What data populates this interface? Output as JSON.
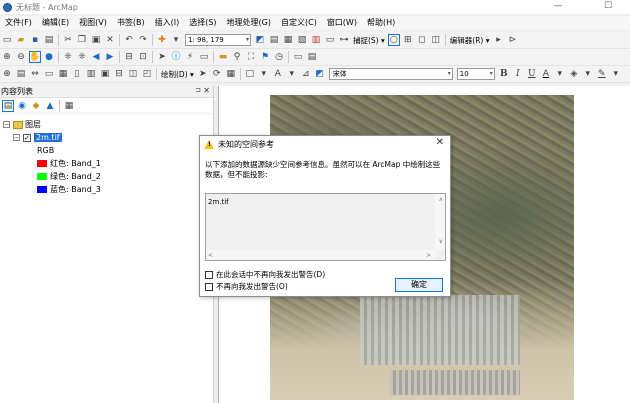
{
  "window": {
    "title": "无标题 - ArcMap",
    "minimize": "—",
    "maximize": "☐"
  },
  "menu": [
    "文件(F)",
    "编辑(E)",
    "视图(V)",
    "书签(B)",
    "插入(I)",
    "选择(S)",
    "地理处理(G)",
    "自定义(C)",
    "窗口(W)",
    "帮助(H)"
  ],
  "toolbar": {
    "scale": "1: 98, 179",
    "snapping_label": "捕捉(S) ▾",
    "editor_label": "编辑器(R) ▾",
    "drawing_label": "绘制(D) ▾",
    "font_name": "宋体",
    "font_size": "10",
    "bold": "B",
    "italic": "I",
    "underline": "U",
    "font_color": "A"
  },
  "toc": {
    "title": "内容列表",
    "pin": "⊐",
    "close": "✕",
    "layers_group": "图层",
    "layer_name": "2m.tif",
    "renderer": "RGB",
    "bands": [
      {
        "channel": "红色:",
        "band": "Band_1",
        "color": "#ff0000"
      },
      {
        "channel": "绿色:",
        "band": "Band_2",
        "color": "#00ff00"
      },
      {
        "channel": "蓝色:",
        "band": "Band_3",
        "color": "#0000ff"
      }
    ]
  },
  "dialog": {
    "title": "未知的空间参考",
    "close": "✕",
    "message": "以下添加的数据源缺少空间参考信息。虽然可以在 ArcMap 中绘制这些数据，但不能投影:",
    "list_items": [
      "2m.tif"
    ],
    "checkbox_session": "在此会话中不再向我发出警告(D)",
    "checkbox_never": "不再向我发出警告(O)",
    "ok_label": "确定"
  },
  "colors": {
    "selection": "#1e6fd9",
    "ok_border": "#1a73d9",
    "warning": "#f2c40f"
  }
}
